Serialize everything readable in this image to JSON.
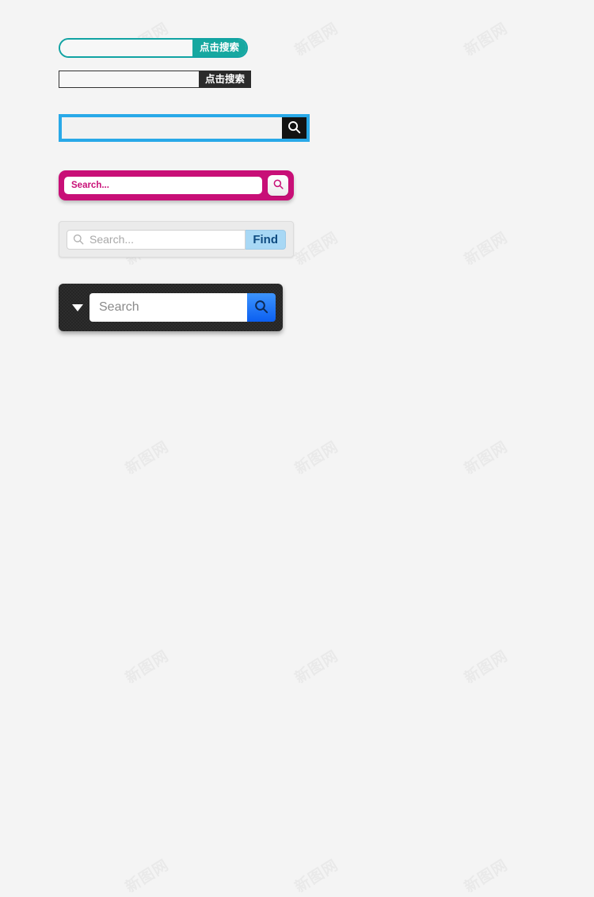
{
  "page": {
    "background_color": "#f4f4f4",
    "watermark_text": "新图网"
  },
  "search_bars": [
    {
      "id": "teal-pill",
      "style_name": "teal-rounded-pill",
      "input_value": "",
      "input_placeholder": "",
      "button_label": "点击搜索",
      "accent_color": "#16a8a0",
      "border_color": "#11a3a3",
      "button_icon": ""
    },
    {
      "id": "black-square",
      "style_name": "black-square-button",
      "input_value": "",
      "input_placeholder": "",
      "button_label": "点击搜索",
      "accent_color": "#2b2b2b",
      "border_color": "#333333",
      "button_icon": ""
    },
    {
      "id": "blue-outline",
      "style_name": "blue-outline-black-icon",
      "input_value": "",
      "input_placeholder": "",
      "button_label": "",
      "accent_color": "#29a9e8",
      "border_color": "#29a9e8",
      "button_icon": "magnifier-icon"
    },
    {
      "id": "magenta-rounded",
      "style_name": "magenta-rounded-card",
      "input_value": "",
      "input_placeholder": "Search...",
      "button_label": "",
      "accent_color": "#c80f77",
      "border_color": "#c80f77",
      "button_icon": "magnifier-icon"
    },
    {
      "id": "gray-find",
      "style_name": "light-gray-find-button",
      "input_value": "",
      "input_placeholder": "Search...",
      "button_label": "Find",
      "accent_color": "#a8d8f5",
      "border_color": "#dcdcdc",
      "button_icon": "magnifier-icon",
      "leading_icon": "magnifier-icon"
    },
    {
      "id": "dark-dropdown",
      "style_name": "dark-textured-dropdown",
      "input_value": "",
      "input_placeholder": "Search",
      "button_label": "",
      "accent_color": "#1a6ef5",
      "border_color": "#252525",
      "button_icon": "magnifier-icon",
      "dropdown_icon": "chevron-down-icon"
    }
  ]
}
